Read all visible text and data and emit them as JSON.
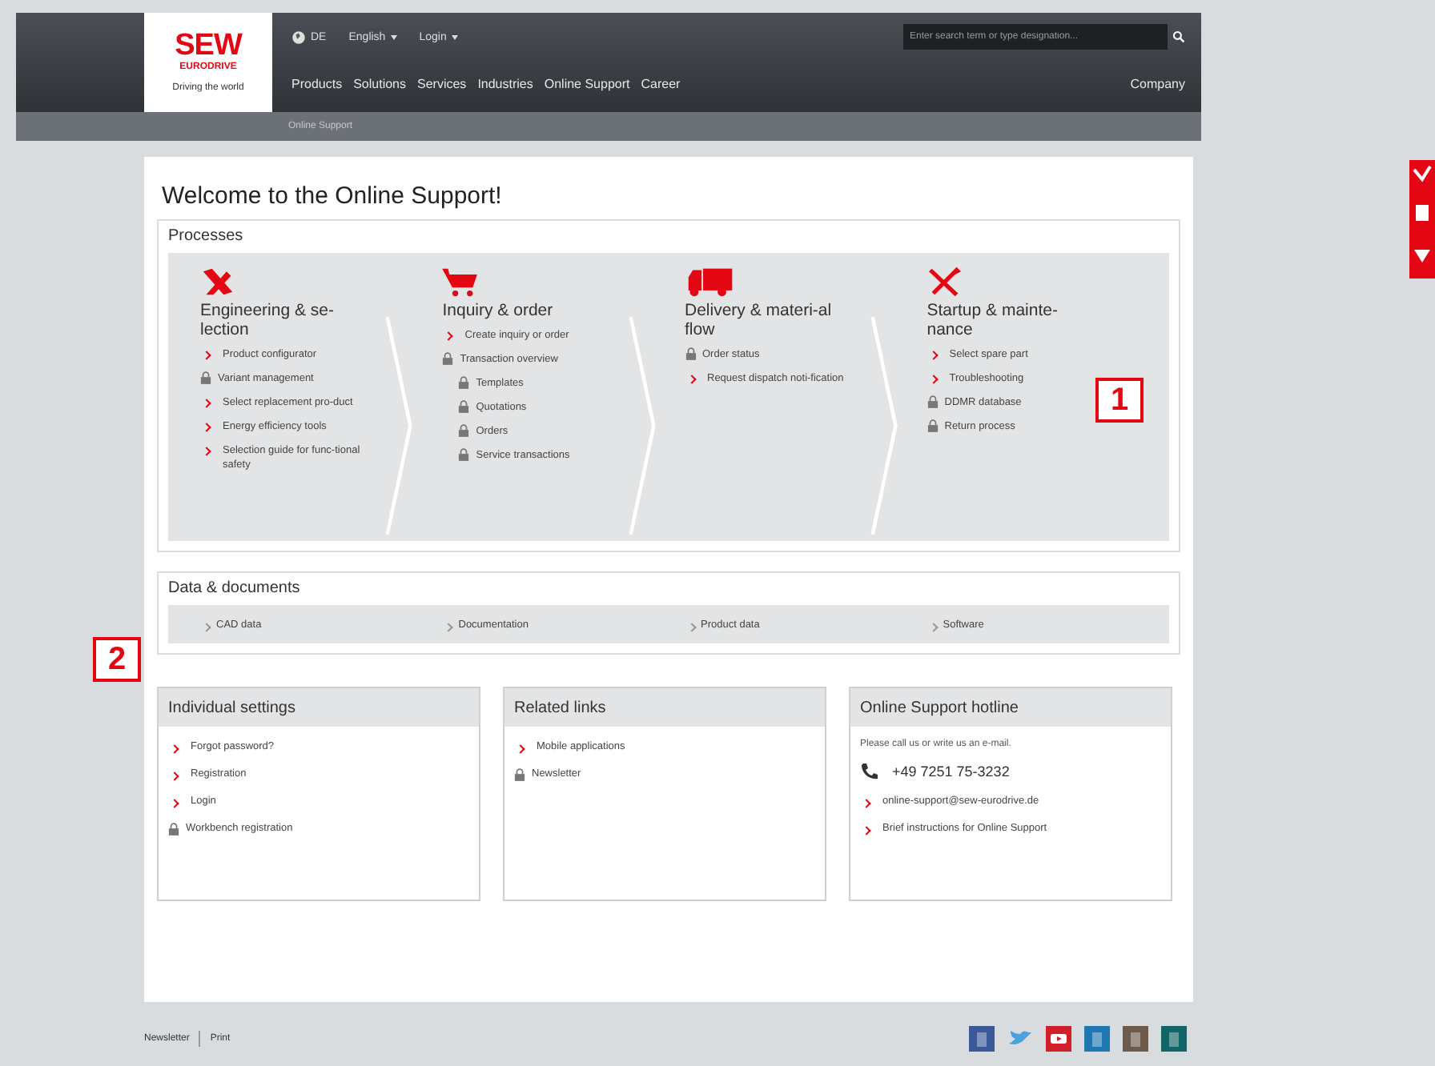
{
  "header": {
    "logo": {
      "brand": "SEW",
      "sub": "EURODRIVE",
      "tagline": "Driving the world"
    },
    "top_links": [
      {
        "label": "DE",
        "kind": "globe"
      },
      {
        "label": "English",
        "kind": "dropdown"
      },
      {
        "label": "Login",
        "kind": "dropdown"
      }
    ],
    "search": {
      "placeholder": "Enter search term or type designation..."
    },
    "nav": [
      {
        "label": "Products"
      },
      {
        "label": "Solutions"
      },
      {
        "label": "Services"
      },
      {
        "label": "Industries"
      },
      {
        "label": "Online Support"
      },
      {
        "label": "Career"
      }
    ],
    "nav_right": "Company",
    "breadcrumb": "Online Support"
  },
  "page_title": "Welcome to the Online Support!",
  "processes": {
    "title": "Processes",
    "steps": [
      {
        "title": "Engineering & se-lection",
        "items": [
          {
            "label": "Product configurator",
            "kind": "link"
          },
          {
            "label": "Variant management",
            "kind": "locked"
          },
          {
            "label": "Select replacement pro-duct",
            "kind": "link"
          },
          {
            "label": "Energy efficiency tools",
            "kind": "link"
          },
          {
            "label": "Selection guide for func-tional safety",
            "kind": "link"
          }
        ]
      },
      {
        "title": "Inquiry & order",
        "items": [
          {
            "label": "Create inquiry or order",
            "kind": "link"
          },
          {
            "label": "Transaction overview",
            "kind": "locked",
            "children": [
              {
                "label": "Templates",
                "kind": "locked"
              },
              {
                "label": "Quotations",
                "kind": "locked"
              },
              {
                "label": "Orders",
                "kind": "locked"
              },
              {
                "label": "Service transactions",
                "kind": "locked"
              }
            ]
          }
        ]
      },
      {
        "title": "Delivery & materi-al flow",
        "items": [
          {
            "label": "Order status",
            "kind": "locked"
          },
          {
            "label": "Request dispatch noti-fication",
            "kind": "link"
          }
        ]
      },
      {
        "title": "Startup & mainte-nance",
        "items": [
          {
            "label": "Select spare part",
            "kind": "link"
          },
          {
            "label": "Troubleshooting",
            "kind": "link"
          },
          {
            "label": "DDMR database",
            "kind": "locked"
          },
          {
            "label": "Return process",
            "kind": "locked"
          }
        ]
      }
    ]
  },
  "documents": {
    "title": "Data & documents",
    "items": [
      {
        "label": "CAD data"
      },
      {
        "label": "Documentation"
      },
      {
        "label": "Product data"
      },
      {
        "label": "Software"
      }
    ]
  },
  "panels": [
    {
      "title": "Individual settings",
      "items": [
        {
          "label": "Forgot password?",
          "kind": "link"
        },
        {
          "label": "Registration",
          "kind": "link"
        },
        {
          "label": "Login",
          "kind": "link"
        },
        {
          "label": "Workbench registration",
          "kind": "locked"
        }
      ]
    },
    {
      "title": "Related links",
      "items": [
        {
          "label": "Mobile applications",
          "kind": "link"
        },
        {
          "label": "Newsletter",
          "kind": "locked"
        }
      ]
    },
    {
      "title": "Online Support hotline",
      "items": [
        {
          "label": "Please call us or write us an e-mail.",
          "kind": "text"
        },
        {
          "label": "+49 7251 75-3232",
          "kind": "phone"
        },
        {
          "label": "online-support@sew-eurodrive.de",
          "kind": "link"
        },
        {
          "label": "Brief instructions for Online Support",
          "kind": "link"
        }
      ]
    }
  ],
  "footer": {
    "links": [
      {
        "label": "Newsletter"
      },
      {
        "label": "Print"
      }
    ]
  },
  "callouts": [
    {
      "label": "1",
      "kind": "processes"
    },
    {
      "label": "2",
      "kind": "documents"
    }
  ]
}
